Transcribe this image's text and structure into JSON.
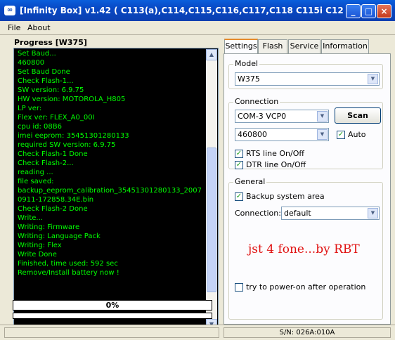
{
  "window": {
    "app_icon": "infinity-logo-icon",
    "title": "[Infinity Box] v1.42    ( C113(a),C114,C115,C116,C117,C118 C115i C121 C122, C123 C13...",
    "minimize": "_",
    "maximize": "□",
    "close": "×"
  },
  "menu": {
    "file": "File",
    "about": "About"
  },
  "progress_panel": {
    "title": "Progress [W375]",
    "log": [
      "Set Baud...",
      "460800",
      "Set Baud Done",
      "Check Flash-1...",
      "SW version: 6.9.75",
      "HW version: MOTOROLA_H805",
      "LP ver:",
      "Flex ver: FLEX_A0_00I",
      "cpu id: 08B6",
      "imei eeprom: 35451301280133",
      "required SW version: 6.9.75",
      "Check Flash-1 Done",
      "Check Flash-2...",
      "reading ...",
      "file saved:",
      "backup_eeprom_calibration_35451301280133_2007",
      "0911-172858.34E.bin",
      "Check Flash-2 Done",
      "Write...",
      "Writing: Firmware",
      "Writing: Language Pack",
      "Writing: Flex",
      "Write Done",
      "Finished, time used: 592 sec",
      "Remove/Install battery now !"
    ],
    "progress_text": "0%",
    "progress_value": 0
  },
  "tabs": {
    "settings": "Settings",
    "flash": "Flash",
    "service": "Service",
    "information": "Information"
  },
  "settings": {
    "model_label": "Model",
    "model_value": "W375",
    "connection_label": "Connection",
    "port_value": "COM-3 VCP0",
    "scan_button": "Scan",
    "baud_value": "460800",
    "auto_label": "Auto",
    "auto_checked": true,
    "rts_label": "RTS line On/Off",
    "rts_checked": true,
    "dtr_label": "DTR line On/Off",
    "dtr_checked": true,
    "general_label": "General",
    "backup_label": "Backup system area",
    "backup_checked": true,
    "conn_label": "Connection:",
    "conn_value": "default",
    "brand_text": "jst 4 fone...by RBT",
    "poweron_label": "try to power-on after operation",
    "poweron_checked": false
  },
  "status": {
    "sn": "S/N: 026A:010A"
  },
  "colors": {
    "log_text": "#00ff00",
    "log_bg": "#000000",
    "brand_text": "#e01010",
    "accent_tab": "#e68b2c"
  }
}
